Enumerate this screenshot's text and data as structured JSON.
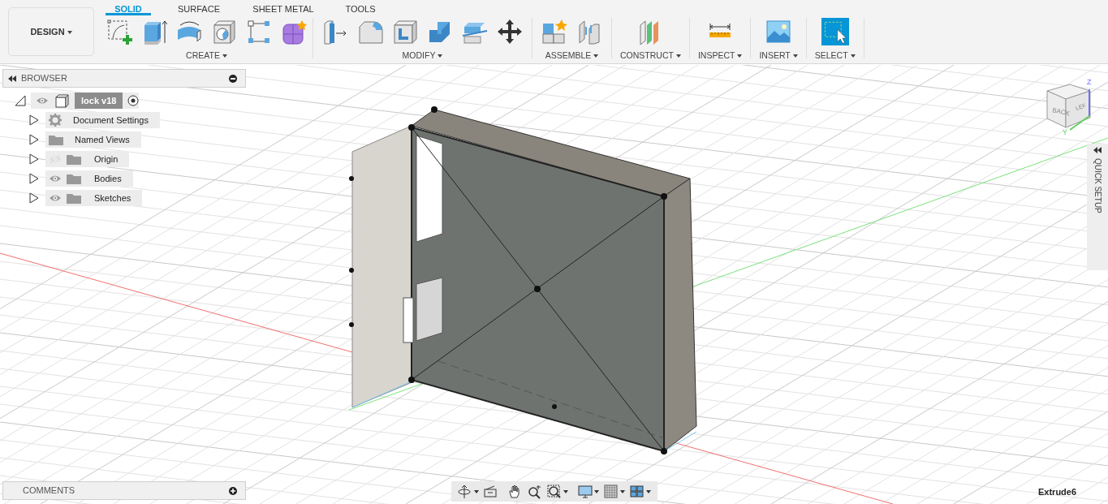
{
  "workspace_button": {
    "label": "DESIGN"
  },
  "tabs": [
    {
      "label": "SOLID",
      "selected": true
    },
    {
      "label": "SURFACE",
      "selected": false
    },
    {
      "label": "SHEET METAL",
      "selected": false
    },
    {
      "label": "TOOLS",
      "selected": false
    }
  ],
  "tool_groups": [
    {
      "label": "CREATE"
    },
    {
      "label": "MODIFY"
    },
    {
      "label": "ASSEMBLE"
    },
    {
      "label": "CONSTRUCT"
    },
    {
      "label": "INSPECT"
    },
    {
      "label": "INSERT"
    },
    {
      "label": "SELECT"
    }
  ],
  "browser": {
    "title": "BROWSER",
    "root": {
      "label": "lock v18",
      "expanded": true,
      "visible": true,
      "children": [
        {
          "label": "Document Settings",
          "kind": "settings",
          "expanded": false
        },
        {
          "label": "Named Views",
          "kind": "views",
          "expanded": false
        },
        {
          "label": "Origin",
          "kind": "folder",
          "visible": false,
          "expanded": false
        },
        {
          "label": "Bodies",
          "kind": "folder",
          "visible": true,
          "expanded": false
        },
        {
          "label": "Sketches",
          "kind": "folder",
          "visible": true,
          "expanded": false
        }
      ]
    }
  },
  "view_cube": {
    "faces": [
      "BACK",
      "LEF"
    ],
    "axes": [
      "Z",
      "Y"
    ]
  },
  "quick_setup": {
    "label": "QUICK SETUP"
  },
  "comments": {
    "title": "COMMENTS"
  },
  "status": "Extrude6"
}
